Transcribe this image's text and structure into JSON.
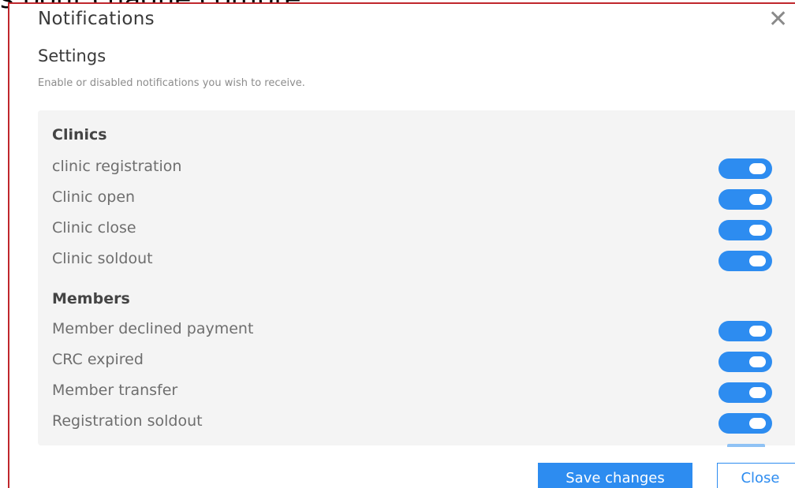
{
  "background_caption": "s pour chaque compte.",
  "modal": {
    "title": "Notifications",
    "close_icon": "close-icon"
  },
  "settings": {
    "title": "Settings",
    "description": "Enable or disabled notifications you wish to receive."
  },
  "groups": [
    {
      "title": "Clinics",
      "items": [
        {
          "label": "clinic registration",
          "enabled": true
        },
        {
          "label": "Clinic open",
          "enabled": true
        },
        {
          "label": "Clinic close",
          "enabled": true
        },
        {
          "label": "Clinic soldout",
          "enabled": true
        }
      ]
    },
    {
      "title": "Members",
      "items": [
        {
          "label": "Member declined payment",
          "enabled": true
        },
        {
          "label": "CRC expired",
          "enabled": true
        },
        {
          "label": "Member transfer",
          "enabled": true
        },
        {
          "label": "Registration soldout",
          "enabled": true
        }
      ]
    }
  ],
  "footer": {
    "save_label": "Save changes",
    "close_label": "Close"
  },
  "colors": {
    "accent": "#2d8cf0",
    "panel_bg": "#f4f4f4",
    "modal_border": "#c0272d"
  }
}
